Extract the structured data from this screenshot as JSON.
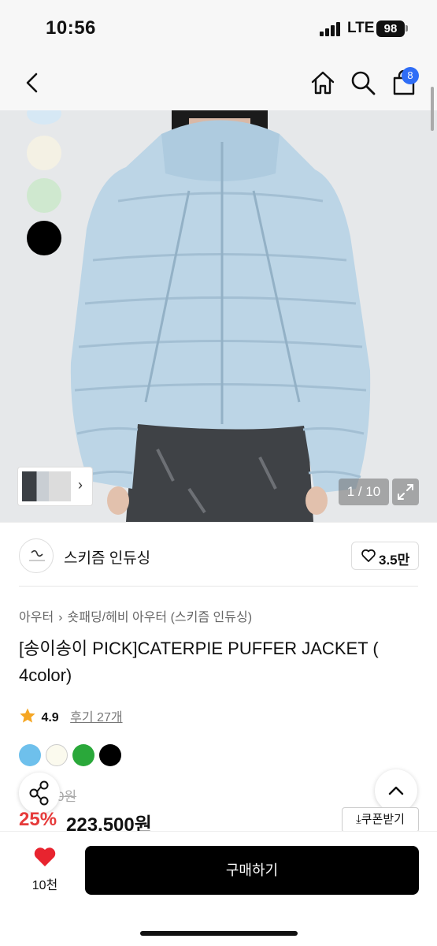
{
  "status_bar": {
    "time": "10:56",
    "network": "LTE",
    "battery": "98"
  },
  "nav": {
    "cart_badge": "8"
  },
  "gallery": {
    "counter": "1 / 10",
    "side_colors": [
      "#d6e8f5",
      "#f4f1e4",
      "#cfe8cf",
      "#000000"
    ]
  },
  "brand": {
    "name": "스키즘 인듀싱",
    "likes": "3.5만"
  },
  "breadcrumb": {
    "level1": "아우터",
    "level2": "숏패딩/헤비 아우터 (스키즘 인듀싱)"
  },
  "product": {
    "title": "[송이송이 PICK]CATERPIE PUFFER JACKET ( 4color)",
    "rating": "4.9",
    "reviews": "후기 27개",
    "colors": [
      "#6ec0ec",
      "#fbfaee",
      "#2aa83a",
      "#000000"
    ],
    "original_price": "0원",
    "discount": "25%",
    "sale_price": "223,500원",
    "coupon_label": "쿠폰받기"
  },
  "bottom": {
    "wish_count": "10천",
    "buy_label": "구매하기"
  }
}
